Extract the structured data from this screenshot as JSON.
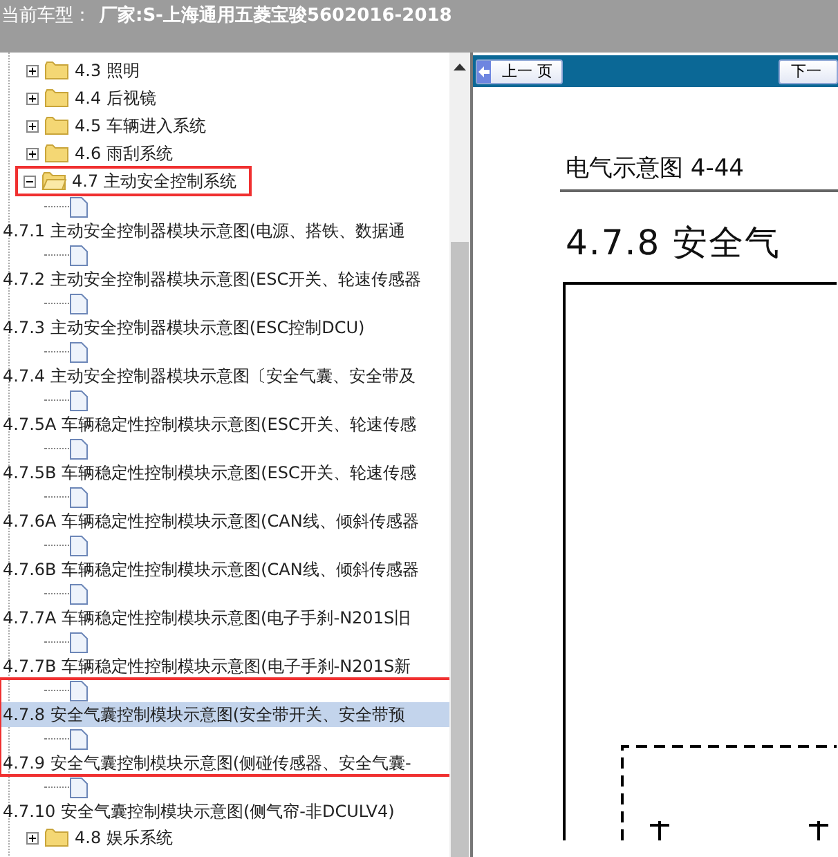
{
  "header": {
    "label": "当前车型：",
    "value": "厂家:S-上海通用五菱宝骏5602016-2018"
  },
  "tree": [
    {
      "label": "4.3 照明",
      "expanded": false,
      "annotated": false
    },
    {
      "label": "4.4 后视镜",
      "expanded": false,
      "annotated": false
    },
    {
      "label": "4.5 车辆进入系统",
      "expanded": false,
      "annotated": false
    },
    {
      "label": "4.6 雨刮系统",
      "expanded": false,
      "annotated": false
    },
    {
      "label": "4.7 主动安全控制系统",
      "expanded": true,
      "annotated": true,
      "children": [
        {
          "label": "4.7.1 主动安全控制器模块示意图(电源、搭铁、数据通",
          "selected": false,
          "annotated": false
        },
        {
          "label": "4.7.2 主动安全控制器模块示意图(ESC开关、轮速传感器",
          "selected": false,
          "annotated": false
        },
        {
          "label": "4.7.3 主动安全控制器模块示意图(ESC控制DCU)",
          "selected": false,
          "annotated": false
        },
        {
          "label": "4.7.4 主动安全控制器模块示意图〔安全气囊、安全带及",
          "selected": false,
          "annotated": false
        },
        {
          "label": "4.7.5A 车辆稳定性控制模块示意图(ESC开关、轮速传感",
          "selected": false,
          "annotated": false
        },
        {
          "label": "4.7.5B 车辆稳定性控制模块示意图(ESC开关、轮速传感",
          "selected": false,
          "annotated": false
        },
        {
          "label": "4.7.6A 车辆稳定性控制模块示意图(CAN线、倾斜传感器",
          "selected": false,
          "annotated": false
        },
        {
          "label": "4.7.6B 车辆稳定性控制模块示意图(CAN线、倾斜传感器",
          "selected": false,
          "annotated": false
        },
        {
          "label": "4.7.7A 车辆稳定性控制模块示意图(电子手刹-N201S旧",
          "selected": false,
          "annotated": false
        },
        {
          "label": "4.7.7B 车辆稳定性控制模块示意图(电子手刹-N201S新",
          "selected": false,
          "annotated": false
        },
        {
          "label": "4.7.8 安全气囊控制模块示意图(安全带开关、安全带预",
          "selected": true,
          "annotated": true
        },
        {
          "label": "4.7.9 安全气囊控制模块示意图(侧碰传感器、安全气囊-",
          "selected": false,
          "annotated": true
        },
        {
          "label": "4.7.10 安全气囊控制模块示意图(侧气帘-非DCULV4)",
          "selected": false,
          "annotated": false
        }
      ]
    },
    {
      "label": "4.8 娱乐系统",
      "expanded": false,
      "annotated": false
    }
  ],
  "toolbar": {
    "prev": "上一 页",
    "next": "下一"
  },
  "document": {
    "caption": "电气示意图 4-44",
    "title": "4.7.8 安全气"
  }
}
